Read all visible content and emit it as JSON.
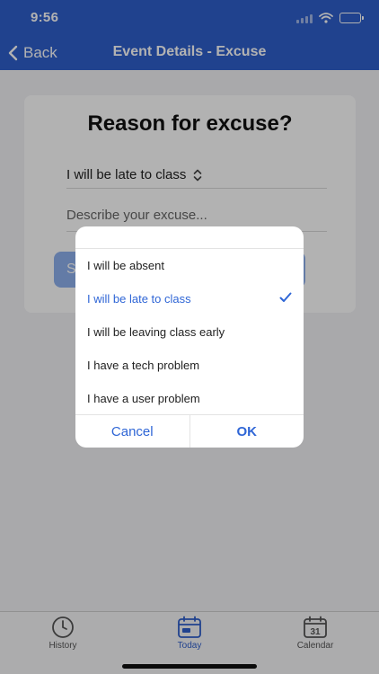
{
  "status_bar": {
    "time": "9:56"
  },
  "nav": {
    "back_label": "Back",
    "title": "Event Details - Excuse"
  },
  "form": {
    "title": "Reason for excuse?",
    "selected_reason": "I will be late to class",
    "excuse_placeholder": "Describe your excuse...",
    "submit_label": "S"
  },
  "picker": {
    "options": [
      {
        "label": "I will be absent",
        "selected": false
      },
      {
        "label": "I will be late to class",
        "selected": true
      },
      {
        "label": "I will be leaving class early",
        "selected": false
      },
      {
        "label": "I have a tech problem",
        "selected": false
      },
      {
        "label": "I have a user problem",
        "selected": false
      }
    ],
    "cancel_label": "Cancel",
    "ok_label": "OK"
  },
  "tabs": [
    {
      "label": "History",
      "icon": "clock-icon",
      "active": false
    },
    {
      "label": "Today",
      "icon": "calendar-today-icon",
      "active": true
    },
    {
      "label": "Calendar",
      "icon": "calendar-31-icon",
      "active": false,
      "day": "31"
    }
  ],
  "colors": {
    "accent": "#2f5fcc",
    "selected_option": "#2f66d6",
    "inactive_tab": "#555555"
  }
}
